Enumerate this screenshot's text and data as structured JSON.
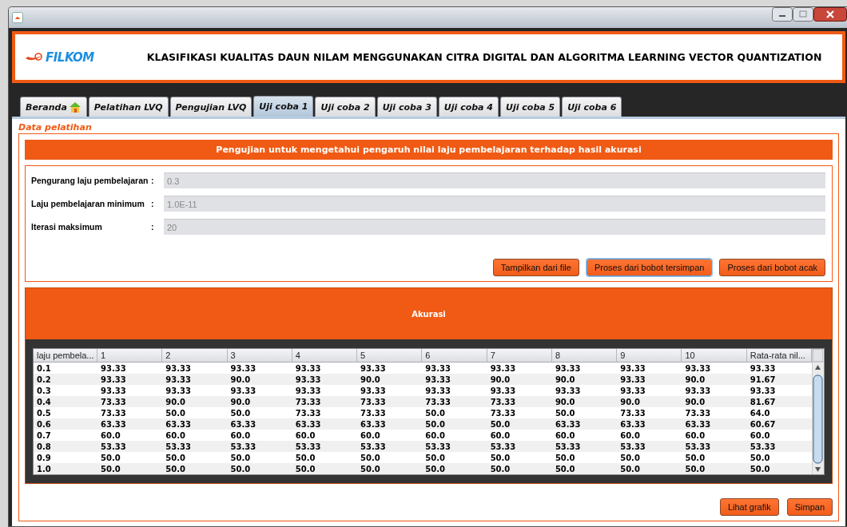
{
  "header": {
    "logo": "FILKOM",
    "title": "KLASIFIKASI KUALITAS DAUN NILAM MENGGUNAKAN CITRA DIGITAL DAN ALGORITMA LEARNING VECTOR QUANTIZATION"
  },
  "tabs": [
    {
      "label": "Beranda",
      "selected": false,
      "kind": "home"
    },
    {
      "label": "Pelatihan LVQ",
      "selected": false,
      "kind": "text"
    },
    {
      "label": "Pengujian LVQ",
      "selected": false,
      "kind": "text"
    },
    {
      "label": "Uji coba 1",
      "selected": true,
      "kind": "text"
    },
    {
      "label": "Uji coba 2",
      "selected": false,
      "kind": "text"
    },
    {
      "label": "Uji coba 3",
      "selected": false,
      "kind": "text"
    },
    {
      "label": "Uji coba 4",
      "selected": false,
      "kind": "text"
    },
    {
      "label": "Uji coba 5",
      "selected": false,
      "kind": "text"
    },
    {
      "label": "Uji coba 6",
      "selected": false,
      "kind": "text"
    }
  ],
  "section_title": "Data pelatihan",
  "banner": "Pengujian untuk mengetahui pengaruh nilai laju pembelajaran terhadap hasil akurasi",
  "fields": [
    {
      "label": "Pengurang laju pembelajaran",
      "colon": ":",
      "value": "0.3"
    },
    {
      "label": "Laju pembelajaran minimum",
      "colon": ":",
      "value": "1.0E-11"
    },
    {
      "label": "Iterasi maksimum",
      "colon": ":",
      "value": "20"
    }
  ],
  "buttons": [
    {
      "label": "Tampilkan dari file",
      "focused": false
    },
    {
      "label": "Proses dari bobot tersimpan",
      "focused": true
    },
    {
      "label": "Proses dari bobot acak",
      "focused": false
    }
  ],
  "results": {
    "title": "Akurasi",
    "columns": [
      "laju pembela...",
      "1",
      "2",
      "3",
      "4",
      "5",
      "6",
      "7",
      "8",
      "9",
      "10",
      "Rata-rata nil..."
    ],
    "rows": [
      [
        "0.1",
        "93.33",
        "93.33",
        "93.33",
        "93.33",
        "93.33",
        "93.33",
        "93.33",
        "93.33",
        "93.33",
        "93.33",
        "93.33"
      ],
      [
        "0.2",
        "93.33",
        "93.33",
        "90.0",
        "93.33",
        "90.0",
        "93.33",
        "90.0",
        "90.0",
        "93.33",
        "90.0",
        "91.67"
      ],
      [
        "0.3",
        "93.33",
        "93.33",
        "93.33",
        "93.33",
        "93.33",
        "93.33",
        "93.33",
        "93.33",
        "93.33",
        "93.33",
        "93.33"
      ],
      [
        "0.4",
        "73.33",
        "90.0",
        "90.0",
        "73.33",
        "73.33",
        "73.33",
        "73.33",
        "90.0",
        "90.0",
        "90.0",
        "81.67"
      ],
      [
        "0.5",
        "73.33",
        "50.0",
        "50.0",
        "73.33",
        "73.33",
        "50.0",
        "73.33",
        "50.0",
        "73.33",
        "73.33",
        "64.0"
      ],
      [
        "0.6",
        "63.33",
        "63.33",
        "63.33",
        "63.33",
        "63.33",
        "50.0",
        "50.0",
        "63.33",
        "63.33",
        "63.33",
        "60.67"
      ],
      [
        "0.7",
        "60.0",
        "60.0",
        "60.0",
        "60.0",
        "60.0",
        "60.0",
        "60.0",
        "60.0",
        "60.0",
        "60.0",
        "60.0"
      ],
      [
        "0.8",
        "53.33",
        "53.33",
        "53.33",
        "53.33",
        "53.33",
        "53.33",
        "53.33",
        "53.33",
        "53.33",
        "53.33",
        "53.33"
      ],
      [
        "0.9",
        "50.0",
        "50.0",
        "50.0",
        "50.0",
        "50.0",
        "50.0",
        "50.0",
        "50.0",
        "50.0",
        "50.0",
        "50.0"
      ],
      [
        "1.0",
        "50.0",
        "50.0",
        "50.0",
        "50.0",
        "50.0",
        "50.0",
        "50.0",
        "50.0",
        "50.0",
        "50.0",
        "50.0"
      ]
    ]
  },
  "footer_buttons": [
    {
      "label": "Lihat grafik",
      "focused": false
    },
    {
      "label": "Simpan",
      "focused": false
    }
  ]
}
